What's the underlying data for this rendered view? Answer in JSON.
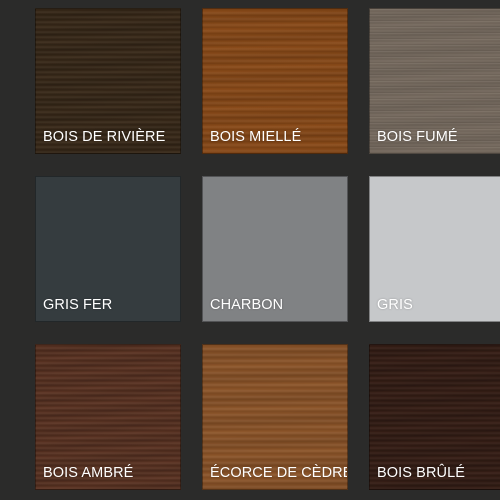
{
  "swatches": [
    {
      "label": "BOIS DE RIVIÈRE",
      "color": "#3b2b1a"
    },
    {
      "label": "BOIS MIELLÉ",
      "color": "#8a4a18"
    },
    {
      "label": "BOIS FUMÉ",
      "color": "#776b5f"
    },
    {
      "label": "GRIS FER",
      "color": "#353c3f"
    },
    {
      "label": "CHARBON",
      "color": "#808284"
    },
    {
      "label": "GRIS",
      "color": "#c6c8ca"
    },
    {
      "label": "BOIS AMBRÉ",
      "color": "#5e3524"
    },
    {
      "label": "ÉCORCE DE CÈDRE",
      "color": "#8c5428"
    },
    {
      "label": "BOIS BRÛLÉ",
      "color": "#3a2118"
    }
  ],
  "background_color": "#2b2b2a"
}
